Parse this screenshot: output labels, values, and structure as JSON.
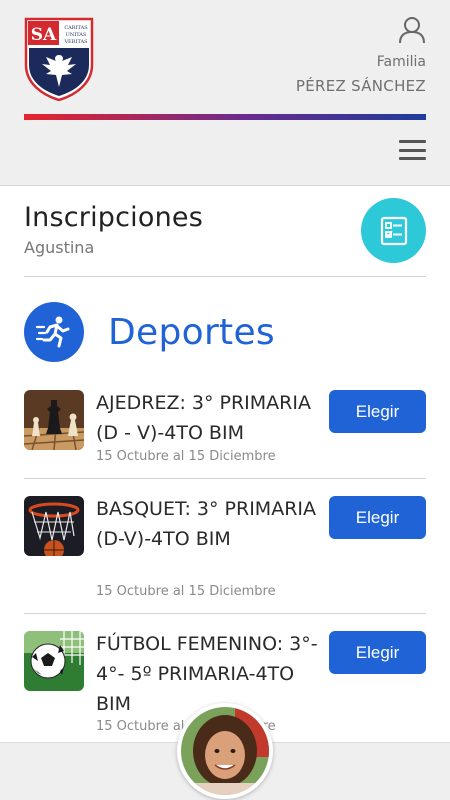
{
  "header": {
    "logo_text": "SA",
    "logo_motto": "CARITAS UNITAS VERITAS",
    "family_label": "Familia",
    "family_name": "PÉREZ SÁNCHEZ"
  },
  "page": {
    "title": "Inscripciones",
    "student": "Agustina"
  },
  "category": {
    "title": "Deportes",
    "icon": "running-person-icon"
  },
  "activities": [
    {
      "name": "AJEDREZ: 3° PRIMARIA (D - V)-4TO BIM",
      "dates": "15 Octubre al 15 Diciembre",
      "button": "Elegir",
      "thumb": "chess-image"
    },
    {
      "name": "BASQUET: 3° PRIMARIA (D-V)-4TO BIM",
      "dates": "15 Octubre al 15 Diciembre",
      "button": "Elegir",
      "thumb": "basketball-hoop-image"
    },
    {
      "name": "FÚTBOL FEMENINO: 3°- 4°- 5º PRIMARIA-4TO BIM",
      "dates": "15 Octubre al 15 Diciembre",
      "button": "Elegir",
      "thumb": "soccer-ball-image"
    }
  ],
  "colors": {
    "primary": "#1f63d6",
    "teal": "#2ec9d9",
    "brand_red": "#e8242c",
    "brand_blue": "#1e3c9e"
  }
}
